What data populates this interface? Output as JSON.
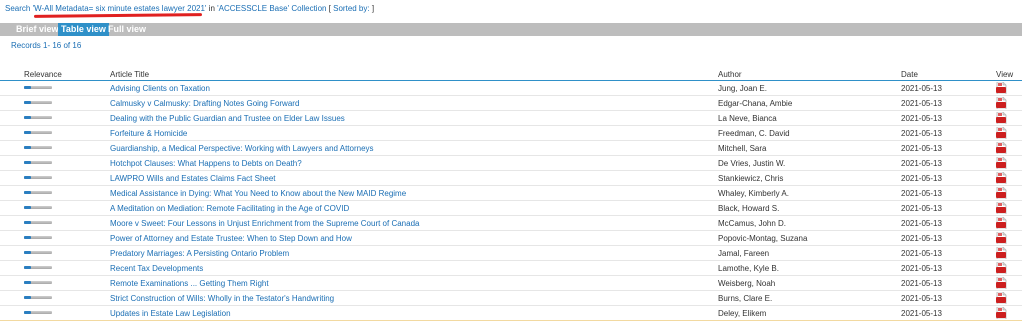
{
  "search": {
    "prefix": "Search ",
    "query": "'W-All Metadata= six minute estates lawyer 2021'",
    "in_text": " in ",
    "base": "'ACCESSCLE Base'",
    "collection": " Collection",
    "bracket_open": " [ ",
    "sorted_by": "Sorted by: ",
    "bracket_close": "]"
  },
  "tabs": [
    "Brief view",
    "Table view",
    "Full view"
  ],
  "active_tab": 1,
  "records": "Records 1- 16 of 16",
  "table": {
    "headers": {
      "relevance": "Relevance",
      "title": "Article Title",
      "author": "Author",
      "date": "Date",
      "view": "View"
    },
    "rows": [
      {
        "title": "Advising Clients on Taxation",
        "author": "Jung, Joan E.",
        "date": "2021-05-13",
        "relevance": 0.25
      },
      {
        "title": "Calmusky v Calmusky: Drafting Notes Going Forward",
        "author": "Edgar-Chana, Ambie",
        "date": "2021-05-13",
        "relevance": 0.25
      },
      {
        "title": "Dealing with the Public Guardian and Trustee on Elder Law Issues",
        "author": "La Neve, Bianca",
        "date": "2021-05-13",
        "relevance": 0.25
      },
      {
        "title": "Forfeiture & Homicide",
        "author": "Freedman, C. David",
        "date": "2021-05-13",
        "relevance": 0.25
      },
      {
        "title": "Guardianship, a Medical Perspective: Working with Lawyers and Attorneys",
        "author": "Mitchell, Sara",
        "date": "2021-05-13",
        "relevance": 0.25
      },
      {
        "title": "Hotchpot Clauses: What Happens to Debts on Death?",
        "author": "De Vries, Justin W.",
        "date": "2021-05-13",
        "relevance": 0.25
      },
      {
        "title": "LAWPRO Wills and Estates Claims Fact Sheet",
        "author": "Stankiewicz, Chris",
        "date": "2021-05-13",
        "relevance": 0.25
      },
      {
        "title": "Medical Assistance in Dying: What You Need to Know about the New MAID Regime",
        "author": "Whaley, Kimberly A.",
        "date": "2021-05-13",
        "relevance": 0.25
      },
      {
        "title": "A Meditation on Mediation: Remote Facilitating in the Age of COVID",
        "author": "Black, Howard S.",
        "date": "2021-05-13",
        "relevance": 0.25
      },
      {
        "title": "Moore v Sweet: Four Lessons in Unjust Enrichment from the Supreme Court of Canada",
        "author": "McCamus, John D.",
        "date": "2021-05-13",
        "relevance": 0.25
      },
      {
        "title": "Power of Attorney and Estate Trustee: When to Step Down and How",
        "author": "Popovic-Montag, Suzana",
        "date": "2021-05-13",
        "relevance": 0.25
      },
      {
        "title": "Predatory Marriages: A Persisting Ontario Problem",
        "author": "Jamal, Fareen",
        "date": "2021-05-13",
        "relevance": 0.25
      },
      {
        "title": "Recent Tax Developments",
        "author": "Lamothe, Kyle B.",
        "date": "2021-05-13",
        "relevance": 0.25
      },
      {
        "title": "Remote Examinations ... Getting Them Right",
        "author": "Weisberg, Noah",
        "date": "2021-05-13",
        "relevance": 0.25
      },
      {
        "title": "Strict Construction of Wills: Wholly in the Testator's Handwriting",
        "author": "Burns, Clare E.",
        "date": "2021-05-13",
        "relevance": 0.25
      },
      {
        "title": "Updates in Estate Law Legislation",
        "author": "Deley, Elikem",
        "date": "2021-05-13",
        "relevance": 0.25
      }
    ]
  },
  "colors": {
    "link": "#1a6eb4",
    "tab_active": "#2f90c8",
    "tabbar": "#bdbdbd",
    "highlight": "#e02020",
    "pdf": "#cc1f1f"
  },
  "icons": {
    "view": "pdf-icon"
  }
}
